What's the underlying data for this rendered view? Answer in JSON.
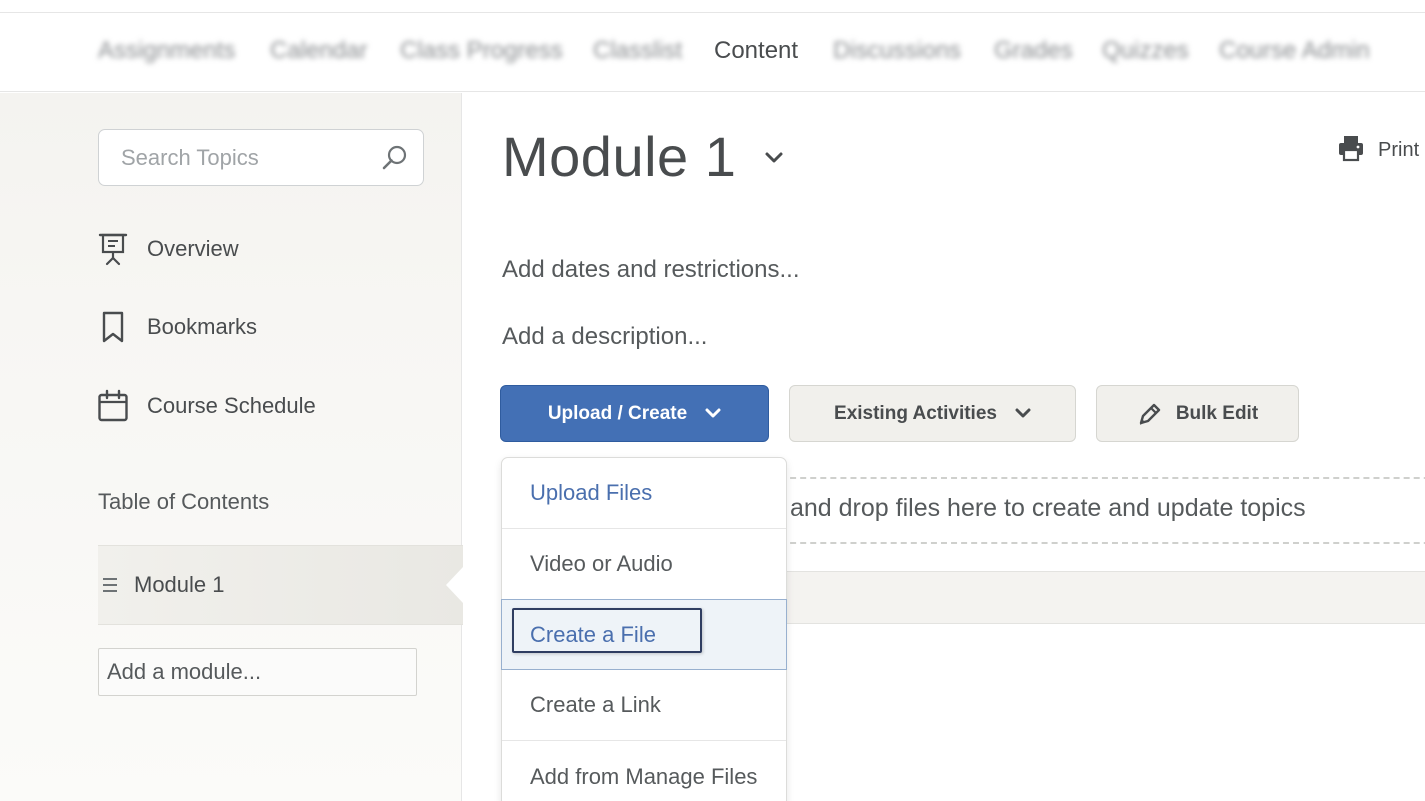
{
  "topnav": {
    "items": [
      {
        "label": "Assignments",
        "blurred": true
      },
      {
        "label": "Calendar",
        "blurred": true
      },
      {
        "label": "Class Progress",
        "blurred": true
      },
      {
        "label": "Classlist",
        "blurred": true
      },
      {
        "label": "Content",
        "blurred": false,
        "active": true
      },
      {
        "label": "Discussions",
        "blurred": true
      },
      {
        "label": "Grades",
        "blurred": true
      },
      {
        "label": "Quizzes",
        "blurred": true
      },
      {
        "label": "Course Admin",
        "blurred": true
      }
    ]
  },
  "sidebar": {
    "search": {
      "placeholder": "Search Topics",
      "value": "",
      "icon": "search-icon"
    },
    "links": [
      {
        "label": "Overview",
        "icon": "presentation-icon"
      },
      {
        "label": "Bookmarks",
        "icon": "bookmark-icon"
      },
      {
        "label": "Course Schedule",
        "icon": "calendar-icon"
      }
    ],
    "toc_heading": "Table of Contents",
    "modules": [
      {
        "label": "Module 1",
        "selected": true
      }
    ],
    "add_module": "Add a module..."
  },
  "main": {
    "title": "Module 1",
    "print_label": "Print",
    "add_dates": "Add dates and restrictions...",
    "add_description": "Add a description...",
    "buttons": {
      "upload_create": "Upload / Create",
      "existing_activities": "Existing Activities",
      "bulk_edit": "Bulk Edit"
    },
    "dropzone_text": "and drop files here to create and update topics"
  },
  "dropdown": {
    "items": [
      {
        "label": "Upload Files",
        "style": "link"
      },
      {
        "label": "Video or Audio",
        "style": "normal"
      },
      {
        "label": "Create a File",
        "style": "link",
        "selected": true
      },
      {
        "label": "Create a Link",
        "style": "normal"
      },
      {
        "label": "Add from Manage Files",
        "style": "normal"
      }
    ]
  },
  "colors": {
    "primary": "#4370b5",
    "link": "#4a6fae",
    "text": "#494c4e",
    "panel": "#f4f3f0",
    "focus": "#2f3d61"
  }
}
